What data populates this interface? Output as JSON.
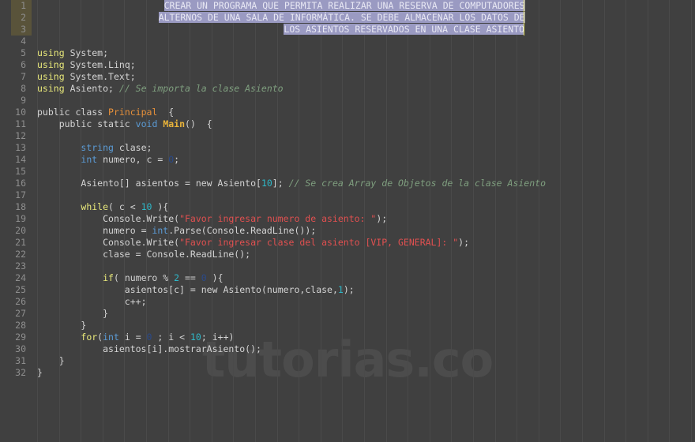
{
  "editor": {
    "title": "C# code editor",
    "language": "C#",
    "background_color": "#404040",
    "selection_color": "#9a9ac2",
    "caret_color": "#e8e45a",
    "gutter_highlight_color": "#59533a",
    "line_number_color": "#8e8e8e",
    "total_lines": 32,
    "watermark": "tutorias.co"
  },
  "gutter": {
    "line_numbers": [
      1,
      2,
      3,
      4,
      5,
      6,
      7,
      8,
      9,
      10,
      11,
      12,
      13,
      14,
      15,
      16,
      17,
      18,
      19,
      20,
      21,
      22,
      23,
      24,
      25,
      26,
      27,
      28,
      29,
      30,
      31,
      32
    ],
    "highlighted_lines": [
      1,
      2,
      3
    ]
  },
  "selection": {
    "active": true,
    "lines": [
      {
        "line": 1,
        "text": "CREAR UN PROGRAMA QUE PERMITA REALIZAR UNA RESERVA DE COMPUTADORES"
      },
      {
        "line": 2,
        "text": "ALTERNOS DE UNA SALA DE INFORMÁTICA. SE DEBE ALMACENAR LOS DATOS DE"
      },
      {
        "line": 3,
        "text": "LOS ASIENTOS RESERVADOS EN UNA CLASE ASIENTO"
      }
    ]
  },
  "code": {
    "lines": [
      {
        "n": 1,
        "text": ""
      },
      {
        "n": 2,
        "text": ""
      },
      {
        "n": 3,
        "text": ""
      },
      {
        "n": 4,
        "text": ""
      },
      {
        "n": 5,
        "text": "using System;"
      },
      {
        "n": 6,
        "text": "using System.Linq;"
      },
      {
        "n": 7,
        "text": "using System.Text;"
      },
      {
        "n": 8,
        "text": "using Asiento; // Se importa la clase Asiento"
      },
      {
        "n": 9,
        "text": ""
      },
      {
        "n": 10,
        "text": "public class Principal  {"
      },
      {
        "n": 11,
        "text": "    public static void Main()  {"
      },
      {
        "n": 12,
        "text": ""
      },
      {
        "n": 13,
        "text": "        string clase;"
      },
      {
        "n": 14,
        "text": "        int numero, c = 0;"
      },
      {
        "n": 15,
        "text": ""
      },
      {
        "n": 16,
        "text": "        Asiento[] asientos = new Asiento[10]; // Se crea Array de Objetos de la clase Asiento"
      },
      {
        "n": 17,
        "text": ""
      },
      {
        "n": 18,
        "text": "        while( c < 10 ){"
      },
      {
        "n": 19,
        "text": "            Console.Write(\"Favor ingresar numero de asiento: \");"
      },
      {
        "n": 20,
        "text": "            numero = int.Parse(Console.ReadLine());"
      },
      {
        "n": 21,
        "text": "            Console.Write(\"Favor ingresar clase del asiento [VIP, GENERAL]: \");"
      },
      {
        "n": 22,
        "text": "            clase = Console.ReadLine();"
      },
      {
        "n": 23,
        "text": ""
      },
      {
        "n": 24,
        "text": "            if( numero % 2 == 0 ){"
      },
      {
        "n": 25,
        "text": "                asientos[c] = new Asiento(numero,clase,1);"
      },
      {
        "n": 26,
        "text": "                c++;"
      },
      {
        "n": 27,
        "text": "            }"
      },
      {
        "n": 28,
        "text": "        }"
      },
      {
        "n": 29,
        "text": "        for(int i = 0 ; i < 10; i++)"
      },
      {
        "n": 30,
        "text": "            asientos[i].mostrarAsiento();"
      },
      {
        "n": 31,
        "text": "    }"
      },
      {
        "n": 32,
        "text": "}"
      }
    ]
  }
}
